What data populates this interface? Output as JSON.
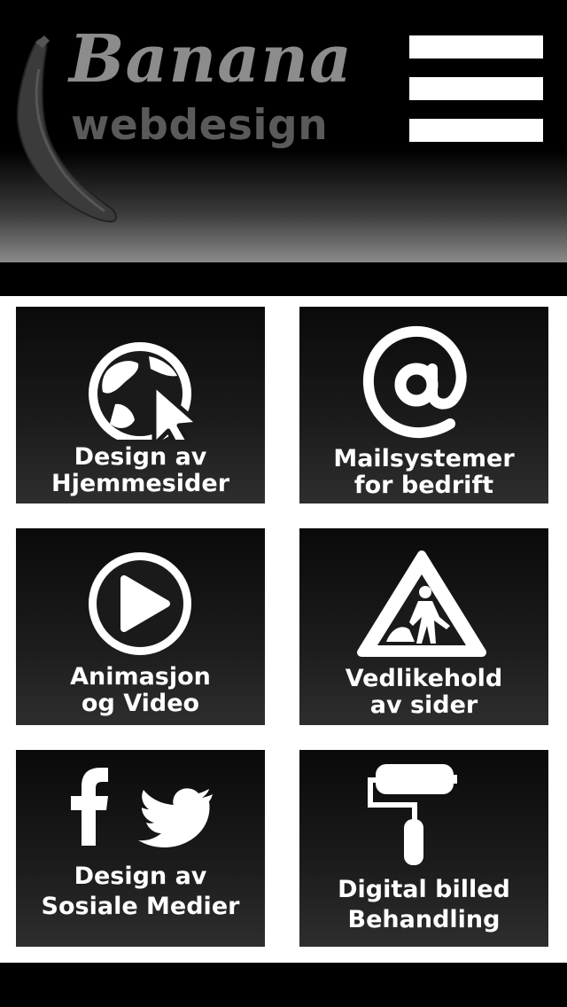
{
  "header": {
    "logo_line1": "Banana",
    "logo_line2": "webdesign",
    "logo_icon": "banana-icon",
    "menu_icon": "hamburger-menu-icon"
  },
  "tiles": [
    {
      "line1": "Design av",
      "line2": "Hjemmesider",
      "icon": "globe-cursor-icon"
    },
    {
      "line1": "Mailsystemer",
      "line2": "for bedrift",
      "icon": "at-sign-icon"
    },
    {
      "line1": "Animasjon",
      "line2": "og Video",
      "icon": "play-icon"
    },
    {
      "line1": "Vedlikehold",
      "line2": "av sider",
      "icon": "road-work-icon"
    },
    {
      "line1": "Design av",
      "line2": "Sosiale Medier",
      "icon": "facebook-twitter-icon"
    },
    {
      "line1": "Digital billed",
      "line2": "Behandling",
      "icon": "paint-roller-icon"
    }
  ],
  "colors": {
    "background": "#000000",
    "content_bg": "#ffffff",
    "tile_text": "#ffffff",
    "logo_primary": "#8c8c8c",
    "logo_secondary": "#5a5a5a"
  }
}
